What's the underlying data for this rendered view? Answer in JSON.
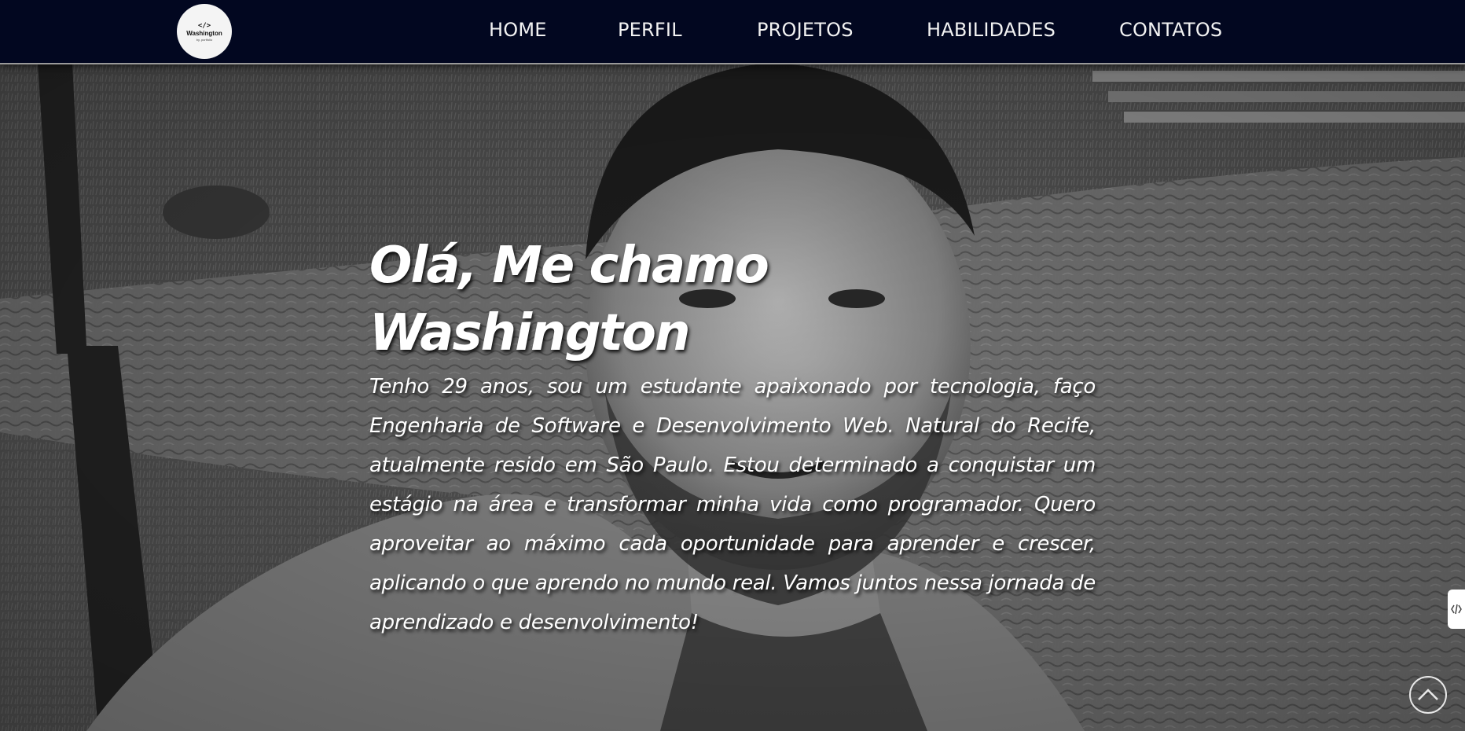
{
  "header": {
    "logo": {
      "code_glyph": "</>",
      "name": "Washington",
      "subtitle": "by, portfolio"
    },
    "nav": [
      {
        "label": "HOME"
      },
      {
        "label": "PERFIL"
      },
      {
        "label": "PROJETOS"
      },
      {
        "label": "HABILIDADES"
      },
      {
        "label": "CONTATOS"
      }
    ]
  },
  "hero": {
    "background": "grayscale selfie photo",
    "heading": "Olá, Me chamo Washington",
    "paragraph": "Tenho 29 anos, sou um estudante apaixonado por tecnologia, faço Engenharia de Software e Desenvolvimento Web. Natural do Recife, atualmente resido em São Paulo. Estou determinado a conquistar um estágio na área e transformar minha vida como programador. Quero aproveitar ao máximo cada oportunidade para aprender e crescer, aplicando o que aprendo no mundo real. Vamos juntos nessa jornada de aprendizado e desenvolvimento!"
  },
  "widgets": {
    "side_tab_icon": "code-icon",
    "back_to_top_icon": "chevron-up-icon"
  },
  "colors": {
    "header_bg": "#020720",
    "nav_text": "#f2f2f2",
    "hero_text": "#ffffff"
  }
}
